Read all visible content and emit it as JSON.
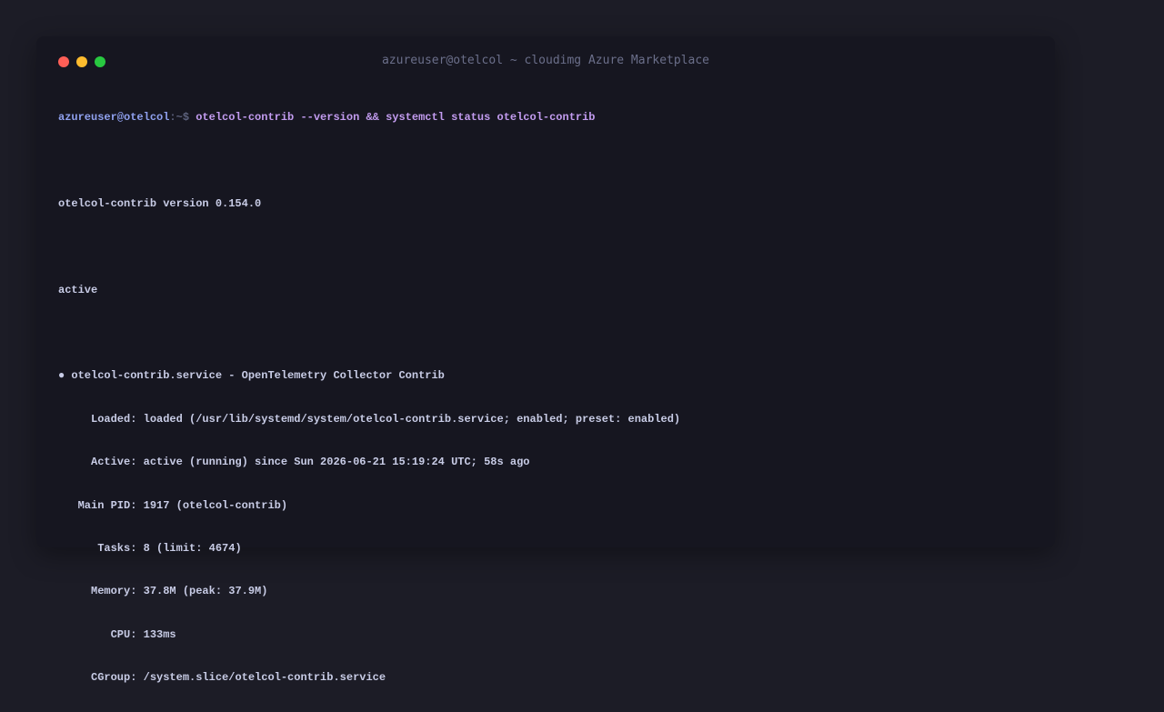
{
  "window": {
    "title": "azureuser@otelcol ~ cloudimg Azure Marketplace",
    "controls": {
      "close_color": "#ff5f57",
      "minimize_color": "#febc2e",
      "maximize_color": "#28c840"
    }
  },
  "terminal": {
    "prompt_user": "azureuser@otelcol",
    "prompt_path": ":~$",
    "command": "otelcol-contrib --version && systemctl status otelcol-contrib",
    "version_line": "otelcol-contrib version 0.154.0",
    "state_line": "active",
    "service": {
      "bullet": "●",
      "header": "otelcol-contrib.service - OpenTelemetry Collector Contrib",
      "fields": [
        {
          "key": "     Loaded:",
          "value": "loaded (/usr/lib/systemd/system/otelcol-contrib.service; enabled; preset: enabled)"
        },
        {
          "key": "     Active:",
          "value": "active (running) since Sun 2026-06-21 15:19:24 UTC; 58s ago"
        },
        {
          "key": "   Main PID:",
          "value": "1917 (otelcol-contrib)"
        },
        {
          "key": "      Tasks:",
          "value": "8 (limit: 4674)"
        },
        {
          "key": "     Memory:",
          "value": "37.8M (peak: 37.9M)"
        },
        {
          "key": "        CPU:",
          "value": "133ms"
        },
        {
          "key": "     CGroup:",
          "value": "/system.slice/otelcol-contrib.service"
        }
      ]
    }
  }
}
